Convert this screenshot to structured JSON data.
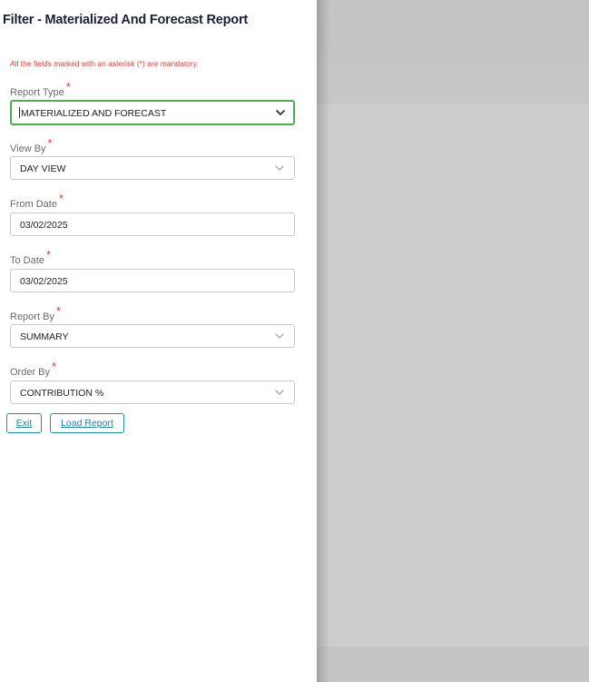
{
  "form": {
    "title": "Filter - Materialized And Forecast Report",
    "mandatory_note": "All the fields marked with an asterisk (*) are mandatory.",
    "required_marker": "*",
    "fields": [
      {
        "label": "Report Type",
        "value": "MATERIALIZED AND FORECAST",
        "kind": "dropdown",
        "focused": true
      },
      {
        "label": "View By",
        "value": "DAY VIEW",
        "kind": "dropdown"
      },
      {
        "label": "From Date",
        "value": "03/02/2025",
        "kind": "date"
      },
      {
        "label": "To Date",
        "value": "03/02/2025",
        "kind": "date"
      },
      {
        "label": "Report By",
        "value": "SUMMARY",
        "kind": "dropdown"
      },
      {
        "label": "Order By",
        "value": "CONTRIBUTION %",
        "kind": "dropdown"
      }
    ]
  },
  "buttons": {
    "exit_label": "Exit",
    "load_label": "Load Report"
  },
  "colors": {
    "required": "#e53935",
    "focus_border": "#4caf50",
    "button_accent": "#1c8ad1"
  },
  "icons": {
    "dropdown": "chevron-down-icon"
  }
}
